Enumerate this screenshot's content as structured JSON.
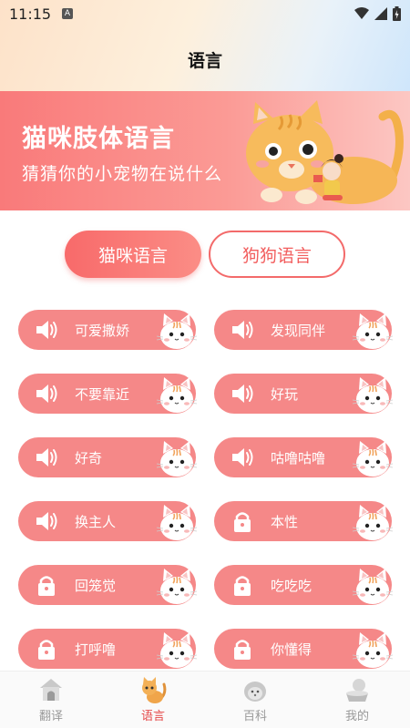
{
  "status_bar": {
    "time": "11:15",
    "notification_badge": "A"
  },
  "header": {
    "title": "语言"
  },
  "banner": {
    "title": "猫咪肢体语言",
    "subtitle": "猜猜你的小宠物在说什么"
  },
  "tabs": [
    {
      "label": "猫咪语言",
      "selected": true
    },
    {
      "label": "狗狗语言",
      "selected": false
    }
  ],
  "items": [
    {
      "label": "可爱撒娇",
      "icon": "speaker-icon",
      "locked": false
    },
    {
      "label": "发现同伴",
      "icon": "speaker-icon",
      "locked": false
    },
    {
      "label": "不要靠近",
      "icon": "speaker-icon",
      "locked": false
    },
    {
      "label": "好玩",
      "icon": "speaker-icon",
      "locked": false
    },
    {
      "label": "好奇",
      "icon": "speaker-icon",
      "locked": false
    },
    {
      "label": "咕噜咕噜",
      "icon": "speaker-icon",
      "locked": false
    },
    {
      "label": "换主人",
      "icon": "speaker-icon",
      "locked": false
    },
    {
      "label": "本性",
      "icon": "lock-icon",
      "locked": true
    },
    {
      "label": "回笼觉",
      "icon": "lock-icon",
      "locked": true
    },
    {
      "label": "吃吃吃",
      "icon": "lock-icon",
      "locked": true
    },
    {
      "label": "打呼噜",
      "icon": "lock-icon",
      "locked": true
    },
    {
      "label": "你懂得",
      "icon": "lock-icon",
      "locked": true
    }
  ],
  "bottom_nav": [
    {
      "label": "翻译",
      "icon": "doghouse-icon",
      "active": false
    },
    {
      "label": "语言",
      "icon": "cat-icon",
      "active": true
    },
    {
      "label": "百科",
      "icon": "hedgehog-icon",
      "active": false
    },
    {
      "label": "我的",
      "icon": "pet-bowl-icon",
      "active": false
    }
  ],
  "colors": {
    "accent": "#f36a6a",
    "pill": "#f58888",
    "nav_active": "#e54a4a",
    "nav_inactive": "#999999"
  }
}
